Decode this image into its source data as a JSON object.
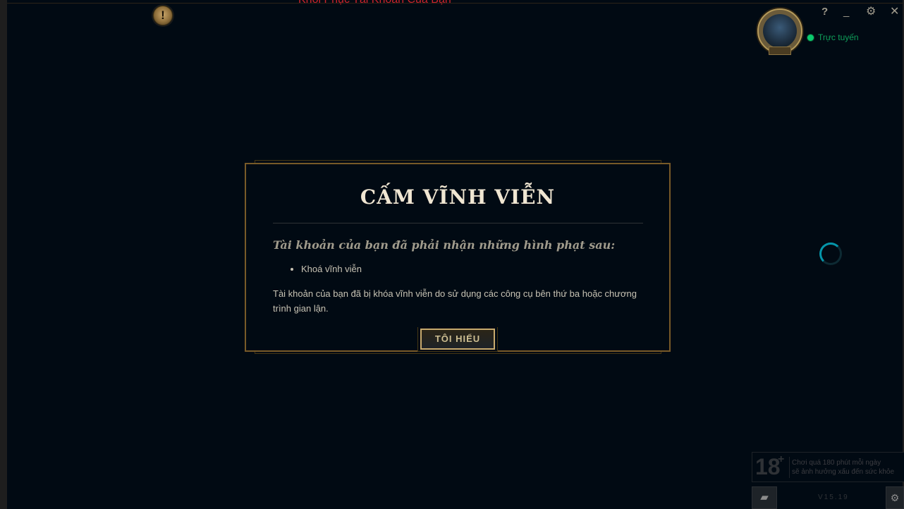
{
  "header": {
    "top_link_text": "Khôi Phục Tài Khoản Của Bạn",
    "alert_icon": "!",
    "status_text": "Trực tuyến",
    "controls": {
      "help": "?",
      "minimize": "_",
      "settings": "⚙",
      "close": "✕"
    }
  },
  "modal": {
    "title": "CẤM VĨNH VIỄN",
    "subtitle": "Tài khoản của bạn đã phải nhận những hình phạt sau:",
    "penalties": [
      "Khoá vĩnh viễn"
    ],
    "body": "Tài khoản của bạn đã bị khóa vĩnh viễn do sử dụng các công cụ bên thứ ba hoặc chương trình gian lận.",
    "button_label": "TÔI HIỂU"
  },
  "footer": {
    "age_number": "18",
    "age_plus": "+",
    "age_line1": "Chơi quá 180 phút mỗi ngày",
    "age_line2": "sẽ ảnh hưởng xấu đến sức khỏe",
    "version": "V15.19",
    "chat_icon": "▰",
    "settings_icon": "⚙"
  },
  "colors": {
    "background": "#010a13",
    "gold": "#c8aa6e",
    "gold_dark": "#785a28",
    "online_green": "#0acb6e",
    "title": "#f0e6d2"
  }
}
